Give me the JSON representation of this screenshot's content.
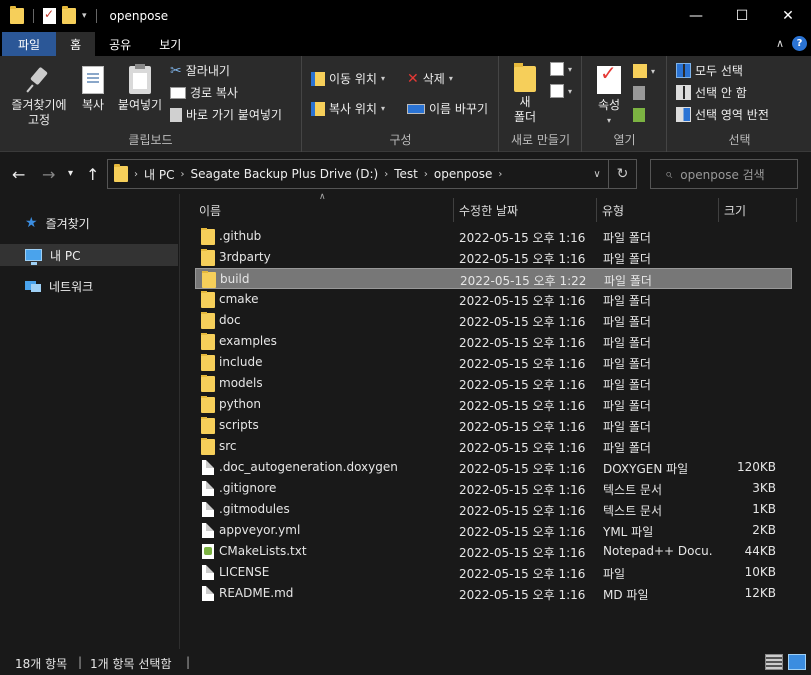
{
  "window": {
    "title": "openpose"
  },
  "tabs": [
    {
      "label": "파일"
    },
    {
      "label": "홈"
    },
    {
      "label": "공유"
    },
    {
      "label": "보기"
    }
  ],
  "ribbon": {
    "clipboard": {
      "pin_label_1": "즐겨찾기에",
      "pin_label_2": "고정",
      "copy": "복사",
      "paste": "붙여넣기",
      "cut": "잘라내기",
      "copy_path": "경로 복사",
      "paste_shortcut": "바로 가기 붙여넣기",
      "group": "클립보드"
    },
    "organize": {
      "move_to": "이동 위치",
      "copy_to": "복사 위치",
      "delete": "삭제",
      "rename": "이름 바꾸기",
      "group": "구성"
    },
    "new": {
      "new_folder_1": "새",
      "new_folder_2": "폴더",
      "group": "새로 만들기"
    },
    "open": {
      "properties": "속성",
      "group": "열기"
    },
    "select": {
      "select_all": "모두 선택",
      "select_none": "선택 안 함",
      "invert": "선택 영역 반전",
      "group": "선택"
    }
  },
  "address": {
    "crumbs": [
      "내 PC",
      "Seagate Backup Plus Drive (D:)",
      "Test",
      "openpose"
    ],
    "search_placeholder": "openpose 검색"
  },
  "nav": [
    {
      "label": "즐겨찾기"
    },
    {
      "label": "내 PC"
    },
    {
      "label": "네트워크"
    }
  ],
  "columns": {
    "name": "이름",
    "date": "수정한 날짜",
    "type": "유형",
    "size": "크기"
  },
  "files": [
    {
      "name": ".github",
      "date": "2022-05-15 오후 1:16",
      "type": "파일 폴더",
      "size": "",
      "kind": "folder"
    },
    {
      "name": "3rdparty",
      "date": "2022-05-15 오후 1:16",
      "type": "파일 폴더",
      "size": "",
      "kind": "folder"
    },
    {
      "name": "build",
      "date": "2022-05-15 오후 1:22",
      "type": "파일 폴더",
      "size": "",
      "kind": "folder",
      "selected": true
    },
    {
      "name": "cmake",
      "date": "2022-05-15 오후 1:16",
      "type": "파일 폴더",
      "size": "",
      "kind": "folder"
    },
    {
      "name": "doc",
      "date": "2022-05-15 오후 1:16",
      "type": "파일 폴더",
      "size": "",
      "kind": "folder"
    },
    {
      "name": "examples",
      "date": "2022-05-15 오후 1:16",
      "type": "파일 폴더",
      "size": "",
      "kind": "folder"
    },
    {
      "name": "include",
      "date": "2022-05-15 오후 1:16",
      "type": "파일 폴더",
      "size": "",
      "kind": "folder"
    },
    {
      "name": "models",
      "date": "2022-05-15 오후 1:16",
      "type": "파일 폴더",
      "size": "",
      "kind": "folder"
    },
    {
      "name": "python",
      "date": "2022-05-15 오후 1:16",
      "type": "파일 폴더",
      "size": "",
      "kind": "folder"
    },
    {
      "name": "scripts",
      "date": "2022-05-15 오후 1:16",
      "type": "파일 폴더",
      "size": "",
      "kind": "folder"
    },
    {
      "name": "src",
      "date": "2022-05-15 오후 1:16",
      "type": "파일 폴더",
      "size": "",
      "kind": "folder"
    },
    {
      "name": ".doc_autogeneration.doxygen",
      "date": "2022-05-15 오후 1:16",
      "type": "DOXYGEN 파일",
      "size": "120KB",
      "kind": "file"
    },
    {
      "name": ".gitignore",
      "date": "2022-05-15 오후 1:16",
      "type": "텍스트 문서",
      "size": "3KB",
      "kind": "file"
    },
    {
      "name": ".gitmodules",
      "date": "2022-05-15 오후 1:16",
      "type": "텍스트 문서",
      "size": "1KB",
      "kind": "file"
    },
    {
      "name": "appveyor.yml",
      "date": "2022-05-15 오후 1:16",
      "type": "YML 파일",
      "size": "2KB",
      "kind": "file"
    },
    {
      "name": "CMakeLists.txt",
      "date": "2022-05-15 오후 1:16",
      "type": "Notepad++ Docu...",
      "size": "44KB",
      "kind": "notepad"
    },
    {
      "name": "LICENSE",
      "date": "2022-05-15 오후 1:16",
      "type": "파일",
      "size": "10KB",
      "kind": "file"
    },
    {
      "name": "README.md",
      "date": "2022-05-15 오후 1:16",
      "type": "MD 파일",
      "size": "12KB",
      "kind": "file"
    }
  ],
  "status": {
    "count": "18개 항목",
    "selected": "1개 항목 선택함"
  }
}
